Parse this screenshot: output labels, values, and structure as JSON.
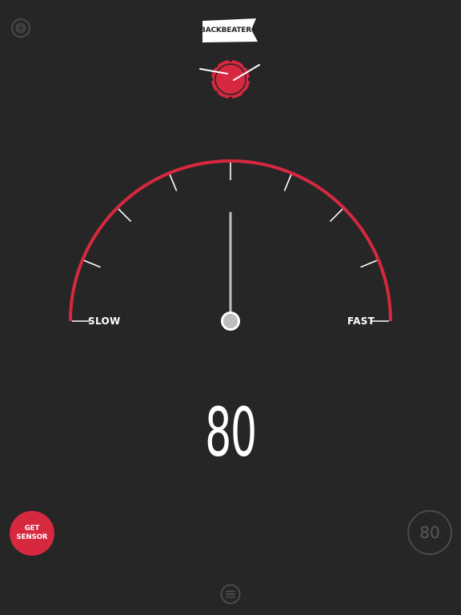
{
  "app": {
    "logo_text": "BACKBEATER"
  },
  "icons": {
    "settings": "gear-icon",
    "drum": "snare-drum-icon",
    "menu": "hamburger-menu-icon"
  },
  "gauge": {
    "left_label": "SLOW",
    "right_label": "FAST",
    "needle_position": 0.5
  },
  "tempo": {
    "bpm": "80"
  },
  "buttons": {
    "get_sensor_line1": "GET",
    "get_sensor_line2": "SENSOR",
    "target_tempo": "80"
  },
  "colors": {
    "background": "#262626",
    "accent": "#d6283f",
    "ticks": "#ffffff",
    "needle": "#bfbfbf"
  }
}
